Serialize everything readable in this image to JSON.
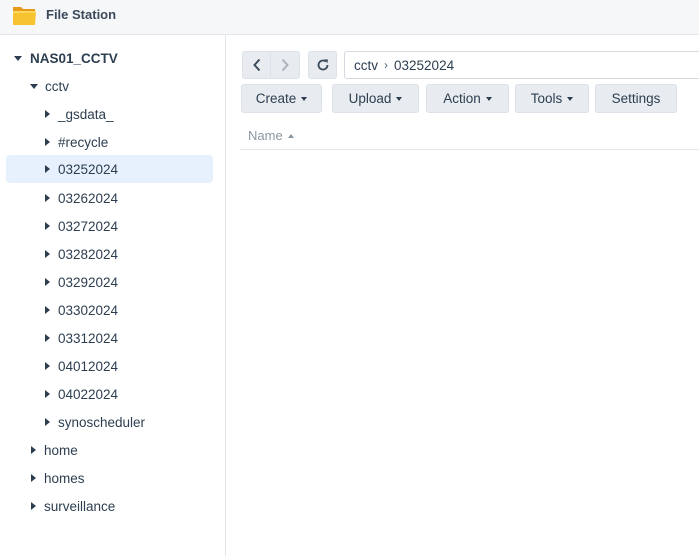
{
  "window": {
    "title": "File Station",
    "icon": "folder-icon"
  },
  "sidebar": {
    "root": {
      "label": "NAS01_CCTV",
      "expanded": true
    },
    "share": {
      "label": "cctv",
      "expanded": true
    },
    "folders": [
      {
        "label": "_gsdata_",
        "selected": false
      },
      {
        "label": "#recycle",
        "selected": false
      },
      {
        "label": "03252024",
        "selected": true
      },
      {
        "label": "03262024",
        "selected": false
      },
      {
        "label": "03272024",
        "selected": false
      },
      {
        "label": "03282024",
        "selected": false
      },
      {
        "label": "03292024",
        "selected": false
      },
      {
        "label": "03302024",
        "selected": false
      },
      {
        "label": "03312024",
        "selected": false
      },
      {
        "label": "04012024",
        "selected": false
      },
      {
        "label": "04022024",
        "selected": false
      },
      {
        "label": "synoscheduler",
        "selected": false
      }
    ],
    "other_shares": [
      {
        "label": "home"
      },
      {
        "label": "homes"
      },
      {
        "label": "surveillance"
      }
    ]
  },
  "navigation": {
    "back_icon": "chevron-left-icon",
    "forward_icon": "chevron-right-icon",
    "refresh_icon": "refresh-icon",
    "path": {
      "parent": "cctv",
      "current": "03252024"
    }
  },
  "toolbar": {
    "create_label": "Create",
    "upload_label": "Upload",
    "action_label": "Action",
    "tools_label": "Tools",
    "settings_label": "Settings"
  },
  "file_list": {
    "columns": [
      {
        "label": "Name",
        "sort": "ascending"
      }
    ],
    "rows": []
  },
  "colors": {
    "accent_selected": "#e6f1fd",
    "button_bg": "#e8ecf0",
    "text": "#2c3e50",
    "muted_text": "#8a96a3",
    "folder_yellow": "#f5b82e"
  }
}
